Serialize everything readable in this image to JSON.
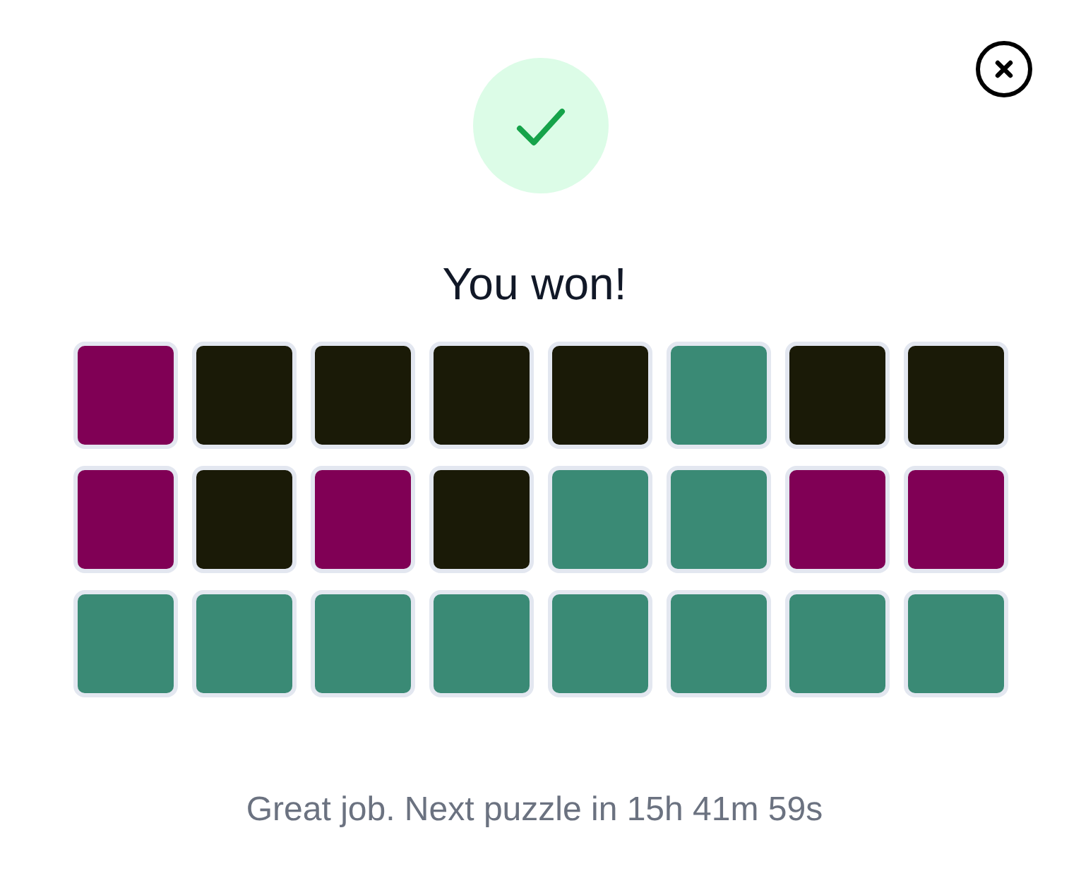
{
  "dialog": {
    "title": "You won!",
    "grid": {
      "rows": [
        {
          "tiles": [
            {
              "color": "#800055"
            },
            {
              "color": "#1a1a07"
            },
            {
              "color": "#1a1a07"
            },
            {
              "color": "#1a1a07"
            },
            {
              "color": "#1a1a07"
            },
            {
              "color": "#3a8a75"
            },
            {
              "color": "#1a1a07"
            },
            {
              "color": "#1a1a07"
            }
          ]
        },
        {
          "tiles": [
            {
              "color": "#800055"
            },
            {
              "color": "#1a1a07"
            },
            {
              "color": "#800055"
            },
            {
              "color": "#1a1a07"
            },
            {
              "color": "#3a8a75"
            },
            {
              "color": "#3a8a75"
            },
            {
              "color": "#800055"
            },
            {
              "color": "#800055"
            }
          ]
        },
        {
          "tiles": [
            {
              "color": "#3a8a75"
            },
            {
              "color": "#3a8a75"
            },
            {
              "color": "#3a8a75"
            },
            {
              "color": "#3a8a75"
            },
            {
              "color": "#3a8a75"
            },
            {
              "color": "#3a8a75"
            },
            {
              "color": "#3a8a75"
            },
            {
              "color": "#3a8a75"
            }
          ]
        }
      ]
    },
    "message": "Great job. Next puzzle in 15h 41m 59s"
  }
}
